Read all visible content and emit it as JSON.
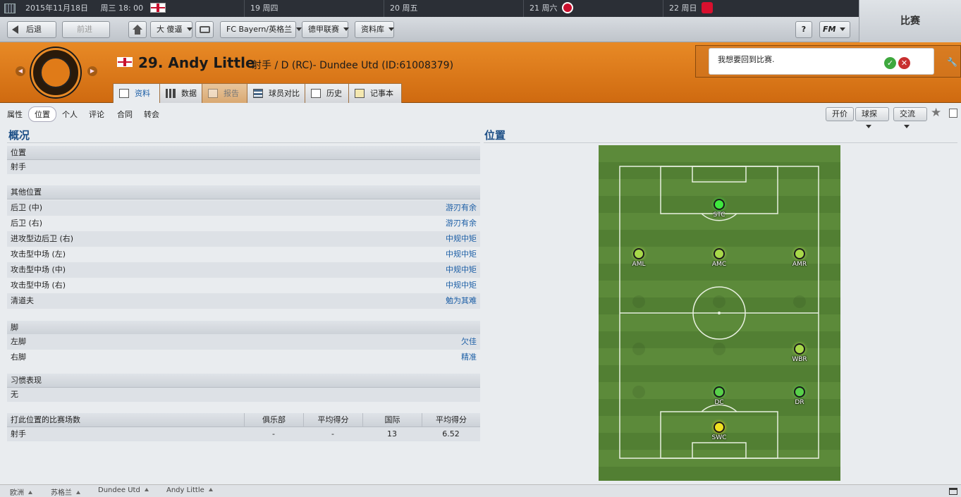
{
  "calendar": {
    "date": "2015年11月18日",
    "weekday_time": "周三 18: 00",
    "days": [
      "19 周四",
      "20 周五",
      "21 周六",
      "22 周日"
    ]
  },
  "toolbar": {
    "back": "后退",
    "forward": "前进",
    "manager": "大 傻逼",
    "club": "FC Bayern/英格兰",
    "league": "德甲联赛",
    "database": "资料库",
    "help": "?",
    "fm": "FM"
  },
  "right_header": {
    "title": "比赛"
  },
  "player": {
    "title": "29. Andy Little",
    "subtitle": "射手 / D (RC)- Dundee Utd (ID:61008379)"
  },
  "tabs": [
    "资料",
    "数据",
    "报告",
    "球员对比",
    "历史",
    "记事本"
  ],
  "notification": {
    "text": "我想要回到比赛."
  },
  "subnav": {
    "items": [
      "属性",
      "位置",
      "个人",
      "评论",
      "合同",
      "转会"
    ],
    "actions": [
      "开价",
      "球探",
      "交流"
    ]
  },
  "left": {
    "title": "概况",
    "position": {
      "header": "位置",
      "value": "射手"
    },
    "other_positions": {
      "header": "其他位置",
      "rows": [
        {
          "name": "后卫 (中)",
          "rating": "游刃有余"
        },
        {
          "name": "后卫 (右)",
          "rating": "游刃有余"
        },
        {
          "name": "进攻型边后卫 (右)",
          "rating": "中规中矩"
        },
        {
          "name": "攻击型中场 (左)",
          "rating": "中规中矩"
        },
        {
          "name": "攻击型中场 (中)",
          "rating": "中规中矩"
        },
        {
          "name": "攻击型中场 (右)",
          "rating": "中规中矩"
        },
        {
          "name": "清道夫",
          "rating": "勉为其难"
        }
      ]
    },
    "feet": {
      "header": "脚",
      "rows": [
        {
          "name": "左脚",
          "rating": "欠佳"
        },
        {
          "name": "右脚",
          "rating": "精准"
        }
      ]
    },
    "habit": {
      "header": "习惯表现",
      "value": "无"
    },
    "apps": {
      "headers": [
        "打此位置的比赛场数",
        "俱乐部",
        "平均得分",
        "国际",
        "平均得分"
      ],
      "row": [
        "射手",
        "-",
        "-",
        "13",
        "6.52"
      ]
    }
  },
  "right": {
    "title": "位置",
    "positions": [
      {
        "label": "STC",
        "color": "#3ee83e"
      },
      {
        "label": "AML",
        "color": "#a8d84a"
      },
      {
        "label": "AMC",
        "color": "#a8d84a"
      },
      {
        "label": "AMR",
        "color": "#a8d84a"
      },
      {
        "label": "WBR",
        "color": "#a8d84a"
      },
      {
        "label": "DC",
        "color": "#58d04a"
      },
      {
        "label": "DR",
        "color": "#58d04a"
      },
      {
        "label": "SWC",
        "color": "#f0e020"
      }
    ]
  },
  "footer": {
    "crumbs": [
      "欧洲",
      "苏格兰",
      "Dundee Utd",
      "Andy Little"
    ]
  }
}
